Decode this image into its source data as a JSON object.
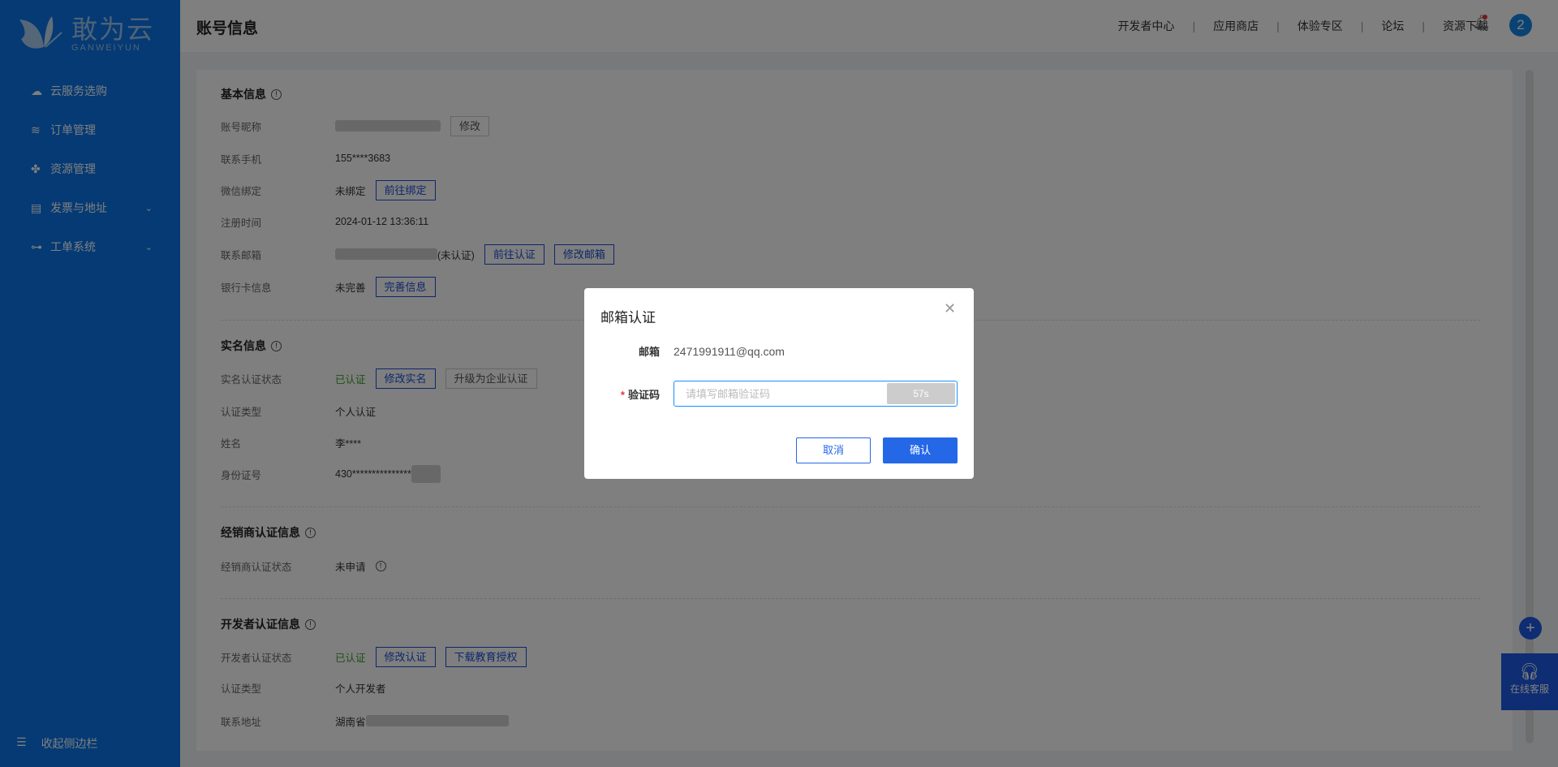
{
  "brand": {
    "name": "敢为云",
    "sub": "GANWEIYUN"
  },
  "sidebar": {
    "items": [
      {
        "label": "云服务选购",
        "icon": "cloud-icon"
      },
      {
        "label": "订单管理",
        "icon": "layers-icon"
      },
      {
        "label": "资源管理",
        "icon": "grid-icon"
      },
      {
        "label": "发票与地址",
        "icon": "document-icon",
        "chevron": "⌄"
      },
      {
        "label": "工单系统",
        "icon": "flow-icon",
        "chevron": "⌄"
      }
    ],
    "collapse": "收起侧边栏"
  },
  "header": {
    "title": "账号信息",
    "nav": [
      "开发者中心",
      "应用商店",
      "体验专区",
      "论坛",
      "资源下载"
    ],
    "avatar": "2"
  },
  "basic": {
    "title": "基本信息",
    "rows": {
      "nickname": {
        "label": "账号昵称",
        "btn": "修改"
      },
      "phone": {
        "label": "联系手机",
        "value": "155****3683"
      },
      "wechat": {
        "label": "微信绑定",
        "value": "未绑定",
        "btn": "前往绑定"
      },
      "reg": {
        "label": "注册时间",
        "value": "2024-01-12 13:36:11"
      },
      "email": {
        "label": "联系邮箱",
        "value": "(未认证)",
        "btn1": "前往认证",
        "btn2": "修改邮箱"
      },
      "bank": {
        "label": "银行卡信息",
        "value": "未完善",
        "btn": "完善信息"
      }
    }
  },
  "realname": {
    "title": "实名信息",
    "rows": {
      "status": {
        "label": "实名认证状态",
        "value": "已认证",
        "btn1": "修改实名",
        "btn2": "升级为企业认证"
      },
      "type": {
        "label": "认证类型",
        "value": "个人认证"
      },
      "name": {
        "label": "姓名",
        "value": "李****"
      },
      "id": {
        "label": "身份证号",
        "value": "430***************"
      }
    }
  },
  "dealer": {
    "title": "经销商认证信息",
    "rows": {
      "status": {
        "label": "经销商认证状态",
        "value": "未申请"
      }
    }
  },
  "developer": {
    "title": "开发者认证信息",
    "rows": {
      "status": {
        "label": "开发者认证状态",
        "value": "已认证",
        "btn1": "修改认证",
        "btn2": "下载教育授权"
      },
      "type": {
        "label": "认证类型",
        "value": "个人开发者"
      },
      "addr": {
        "label": "联系地址",
        "value": "湖南省"
      }
    }
  },
  "float": {
    "service": "在线客服"
  },
  "modal": {
    "title": "邮箱认证",
    "email_label": "邮箱",
    "email": "2471991911@qq.com",
    "code_label": "验证码",
    "required": "*",
    "placeholder": "请填写邮箱验证码",
    "countdown": "57s",
    "cancel": "取消",
    "confirm": "确认"
  }
}
